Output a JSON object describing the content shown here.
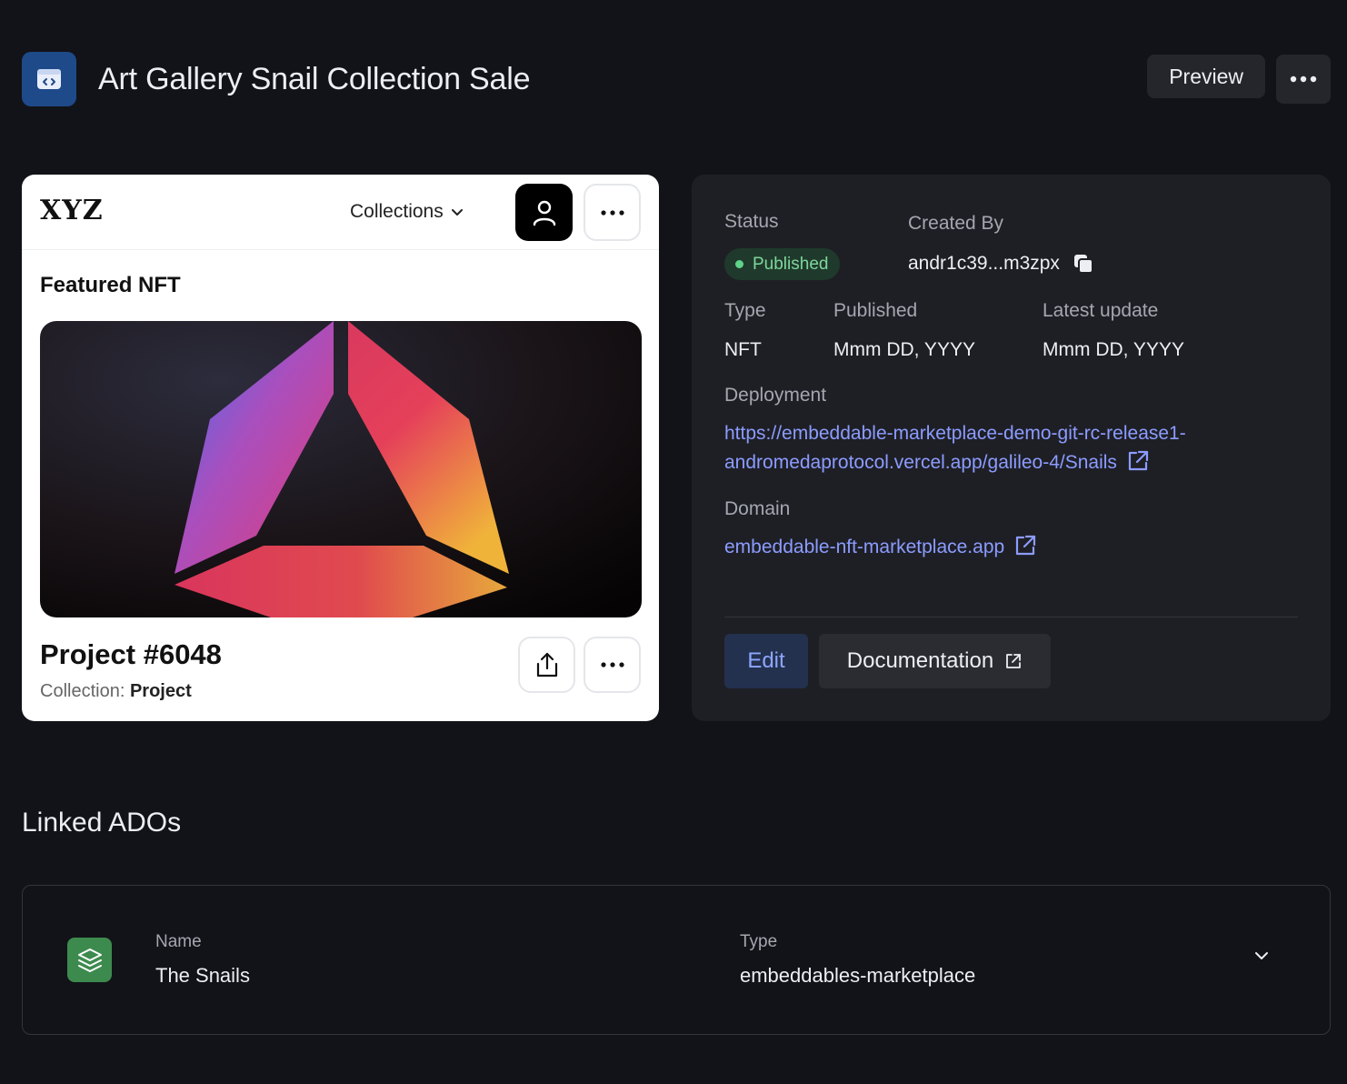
{
  "header": {
    "title": "Art Gallery Snail Collection Sale",
    "app_icon": "code-window-icon",
    "preview_label": "Preview",
    "more_icon": "more-horizontal-icon"
  },
  "preview_card": {
    "logo": "XYZ",
    "nav_collections": "Collections",
    "featured_heading": "Featured NFT",
    "project_title": "Project #6048",
    "collection_label": "Collection:",
    "collection_value": "Project"
  },
  "details": {
    "status_label": "Status",
    "status_value": "Published",
    "created_by_label": "Created By",
    "created_by_value": "andr1c39...m3zpx",
    "type_label": "Type",
    "type_value": "NFT",
    "published_label": "Published",
    "published_value": "Mmm DD, YYYY",
    "latest_update_label": "Latest update",
    "latest_update_value": "Mmm DD, YYYY",
    "deployment_label": "Deployment",
    "deployment_url_line1": "https://embeddable-marketplace-demo-git-rc-release1-",
    "deployment_url_line2": "andromedaprotocol.vercel.app/galileo-4/Snails",
    "domain_label": "Domain",
    "domain_value": "embeddable-nft-marketplace.app",
    "edit_label": "Edit",
    "documentation_label": "Documentation"
  },
  "linked_ados": {
    "heading": "Linked ADOs",
    "rows": [
      {
        "icon": "layers-icon",
        "name_label": "Name",
        "name_value": "The Snails",
        "type_label": "Type",
        "type_value": "embeddables-marketplace"
      }
    ]
  },
  "colors": {
    "background": "#121318",
    "panel": "#1e1f25",
    "accent_link": "#8c9cff",
    "status_green": "#7fd69b",
    "app_icon_bg": "#1e4a8a",
    "ado_icon_bg": "#3d8a4f"
  }
}
